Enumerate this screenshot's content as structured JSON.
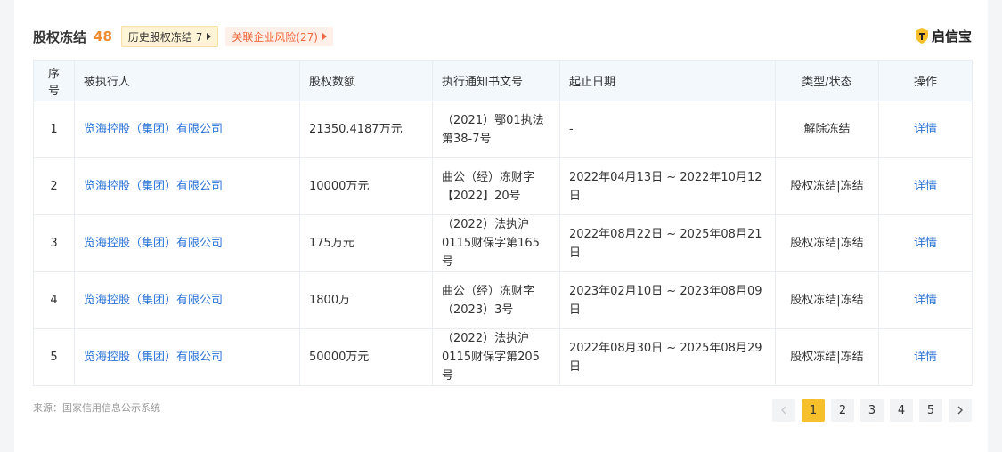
{
  "header": {
    "title": "股权冻结",
    "count": "48",
    "history_tag": "历史股权冻结 7",
    "risk_tag": "关联企业风险(27)"
  },
  "brand": {
    "name": "启信宝",
    "color": "#f6c02c"
  },
  "table": {
    "columns": [
      "序号",
      "被执行人",
      "股权数额",
      "执行通知书文号",
      "起止日期",
      "类型/状态",
      "操作"
    ],
    "rows": [
      {
        "seq": "1",
        "party": "览海控股（集团）有限公司",
        "amount": "21350.4187万元",
        "doc": "（2021）鄂01执法第38-7号",
        "dates": "-",
        "type": "解除冻结",
        "op": "详情"
      },
      {
        "seq": "2",
        "party": "览海控股（集团）有限公司",
        "amount": "10000万元",
        "doc": "曲公（经）冻财字【2022】20号",
        "dates": "2022年04月13日 ~ 2022年10月12日",
        "type": "股权冻结|冻结",
        "op": "详情"
      },
      {
        "seq": "3",
        "party": "览海控股（集团）有限公司",
        "amount": "175万元",
        "doc": "（2022）法执沪0115财保字第165号",
        "dates": "2022年08月22日 ~ 2025年08月21日",
        "type": "股权冻结|冻结",
        "op": "详情"
      },
      {
        "seq": "4",
        "party": "览海控股（集团）有限公司",
        "amount": "1800万",
        "doc": "曲公（经）冻财字（2023）3号",
        "dates": "2023年02月10日 ~ 2023年08月09日",
        "type": "股权冻结|冻结",
        "op": "详情"
      },
      {
        "seq": "5",
        "party": "览海控股（集团）有限公司",
        "amount": "50000万元",
        "doc": "（2022）法执沪0115财保字第205号",
        "dates": "2022年08月30日 ~ 2025年08月29日",
        "type": "股权冻结|冻结",
        "op": "详情"
      }
    ]
  },
  "footer": {
    "source": "来源：国家信用信息公示系统"
  },
  "pagination": {
    "prev_icon": "chevron-left-icon",
    "next_icon": "chevron-right-icon",
    "pages": [
      "1",
      "2",
      "3",
      "4",
      "5"
    ],
    "current": "1",
    "active_color": "#f6c02c"
  }
}
